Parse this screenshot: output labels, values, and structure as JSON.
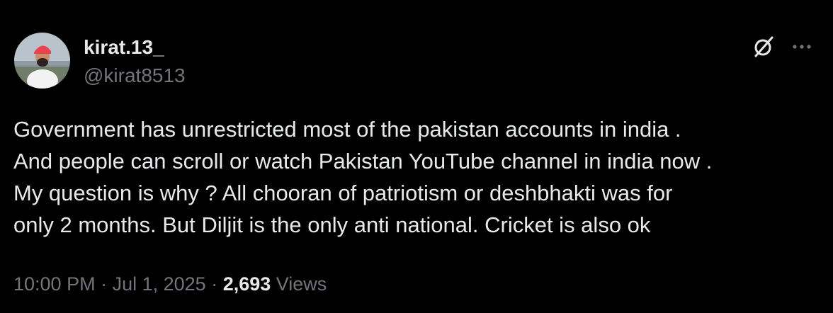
{
  "author": {
    "display_name": "kirat.13_",
    "handle": "@kirat8513",
    "avatar_icon": "profile-photo"
  },
  "actions": {
    "grok_icon": "grok-icon",
    "more_icon": "more-icon"
  },
  "tweet": {
    "lines": [
      "Government has unrestricted most of the pakistan accounts in india .",
      "And people can scroll or watch Pakistan YouTube channel in india now .",
      "My question is why ? All chooran of patriotism or deshbhakti was for",
      "only 2 months. But Diljit is the only anti national. Cricket is also ok"
    ]
  },
  "meta": {
    "time": "10:00 PM",
    "separator1": " · ",
    "date": "Jul 1, 2025",
    "separator2": " · ",
    "views_count": "2,693",
    "views_label": " Views"
  },
  "colors": {
    "background": "#000000",
    "primary_text": "#e7e9ea",
    "secondary_text": "#71767b",
    "avatar_turban": "#e8434e"
  }
}
